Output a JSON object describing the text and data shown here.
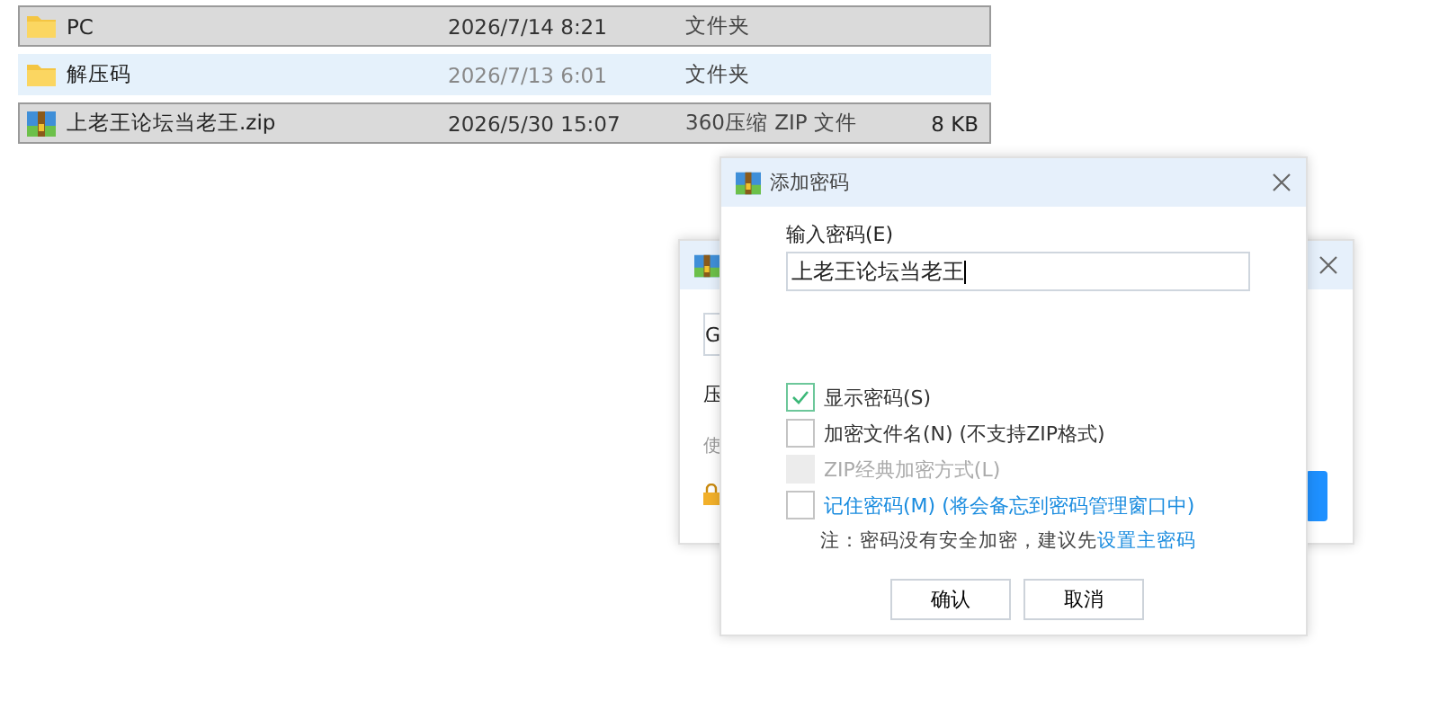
{
  "files": [
    {
      "kind": "folder",
      "name": "PC",
      "date": "2026/7/14 8:21",
      "type": "文件夹",
      "selected": true,
      "hovered": false
    },
    {
      "kind": "folder",
      "name": "解压码",
      "date": "2026/7/13 6:01",
      "type": "文件夹",
      "selected": false,
      "hovered": true
    },
    {
      "kind": "archive",
      "name": "上老王论坛当老王.zip",
      "date": "2026/5/30 15:07",
      "type": "360压缩 ZIP 文件",
      "size": "8 KB",
      "selected": true,
      "hovered": false
    }
  ],
  "back_window": {
    "field_text": "G",
    "label": "压",
    "hint": "使"
  },
  "dialog": {
    "title": "添加密码",
    "password_label": "输入密码(E)",
    "password_value": "上老王论坛当老王",
    "options": [
      {
        "kind": "check",
        "label": "显示密码(S)",
        "checked": true,
        "disabled": false
      },
      {
        "kind": "check",
        "label": "加密文件名(N) (不支持ZIP格式)",
        "checked": false,
        "disabled": false
      },
      {
        "kind": "check",
        "label": "ZIP经典加密方式(L)",
        "checked": false,
        "disabled": true
      },
      {
        "kind": "link",
        "label": "记住密码(M) (将会备忘到密码管理窗口中)",
        "checked": false,
        "disabled": false
      }
    ],
    "note": "注：密码没有安全加密，建议先",
    "note_link": "设置主密码",
    "buttons": [
      "确认",
      "取消"
    ]
  }
}
